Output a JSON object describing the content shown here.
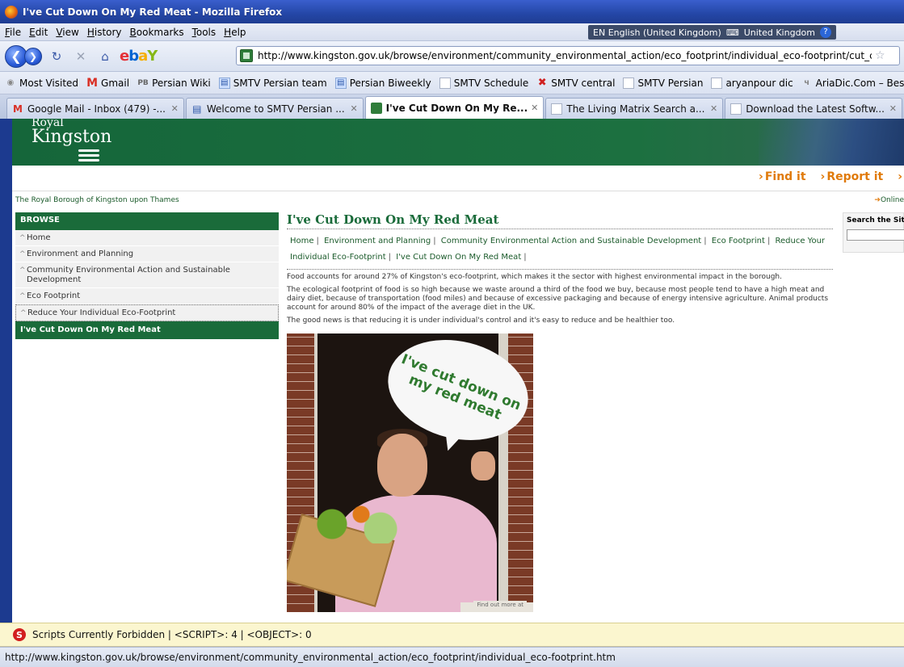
{
  "window": {
    "title": "I've Cut Down On My Red Meat - Mozilla Firefox"
  },
  "menu": [
    "File",
    "Edit",
    "View",
    "History",
    "Bookmarks",
    "Tools",
    "Help"
  ],
  "language_bar": {
    "language": "EN English (United Kingdom)",
    "keyboard": "United Kingdom",
    "help": "?"
  },
  "nav": {
    "url": "http://www.kingston.gov.uk/browse/environment/community_environmental_action/eco_footprint/individual_eco-footprint/cut_c",
    "ebay": {
      "e": "e",
      "b": "b",
      "a": "a",
      "y": "Y"
    }
  },
  "bookmarks": [
    {
      "label": "Most Visited",
      "icon": "compass-icon"
    },
    {
      "label": "Gmail",
      "icon": "gmail-icon"
    },
    {
      "label": "Persian Wiki",
      "icon": "pb-icon"
    },
    {
      "label": "SMTV Persian team",
      "icon": "smtv-icon"
    },
    {
      "label": "Persian Biweekly",
      "icon": "smtv-icon"
    },
    {
      "label": "SMTV Schedule",
      "icon": "page-icon"
    },
    {
      "label": "SMTV central",
      "icon": "red-icon"
    },
    {
      "label": "SMTV Persian",
      "icon": "page-icon"
    },
    {
      "label": "aryanpour dic",
      "icon": "page-icon"
    },
    {
      "label": "AriaDic.Com – Best Or",
      "icon": "aria-icon"
    }
  ],
  "tabs": [
    {
      "label": "Google Mail - Inbox (479) -...",
      "active": false
    },
    {
      "label": "Welcome to SMTV Persian ...",
      "active": false
    },
    {
      "label": "I've Cut Down On My Re...",
      "active": true
    },
    {
      "label": "The Living Matrix Search a...",
      "active": false
    },
    {
      "label": "Download the Latest Softw...",
      "active": false
    }
  ],
  "site": {
    "logo_royal": "Royal",
    "logo_kingston": "Kingston",
    "quick_links": [
      "Find it",
      "Report it"
    ],
    "borough": "The Royal Borough of Kingston upon Thames",
    "online": "Online"
  },
  "sidebar": {
    "heading": "BROWSE",
    "items": [
      "Home",
      "Environment and Planning",
      "Community Environmental Action and Sustainable Development",
      "Eco Footprint",
      "Reduce Your Individual Eco-Footprint",
      "I've Cut Down On My Red Meat"
    ]
  },
  "main": {
    "title": "I've Cut Down On My Red Meat",
    "crumbs": [
      "Home",
      "Environment and Planning",
      "Community Environmental Action and Sustainable Development",
      "Eco Footprint",
      "Reduce Your Individual Eco-Footprint",
      "I've Cut Down On My Red Meat"
    ],
    "paragraphs": [
      "Food accounts for around 27% of Kingston's eco-footprint, which makes it the sector with highest environmental impact in the borough.",
      "The ecological footprint of food is so high because we waste around a third of the food we buy, because most people tend to have a high meat and dairy diet, because of transportation (food miles) and because of excessive packaging and because of energy intensive agriculture. Animal products account for around 80% of the impact of the average diet in the UK.",
      "The good news is that reducing it is under individual's control and it's easy to reduce and be healthier too."
    ],
    "bubble_text": "I've cut down on my red meat",
    "photo_caption": "Find out more at"
  },
  "search": {
    "label": "Search the Site"
  },
  "noscript": {
    "text": "Scripts Currently Forbidden | <SCRIPT>: 4 | <OBJECT>: 0"
  },
  "status": {
    "text": "http://www.kingston.gov.uk/browse/environment/community_environmental_action/eco_footprint/individual_eco-footprint.htm"
  }
}
